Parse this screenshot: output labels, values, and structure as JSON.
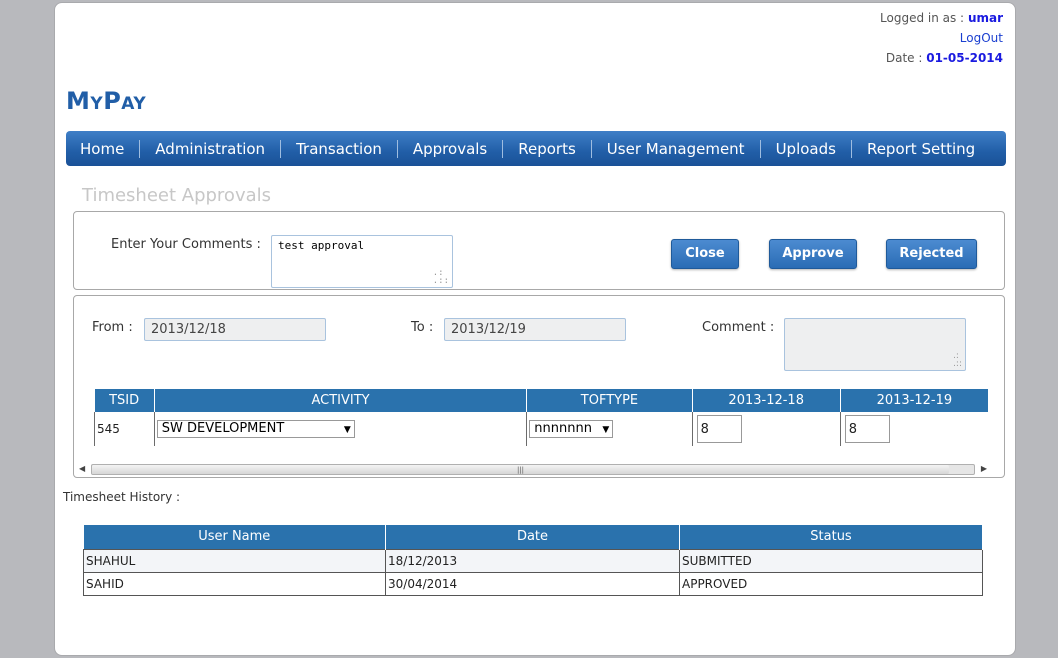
{
  "user": {
    "logged_in_label": "Logged in as :",
    "username": "umar",
    "logout": "LogOut",
    "date_label": "Date :",
    "date": "01-05-2014"
  },
  "brand": {
    "logo": "MyPay",
    "color": "#215ea7"
  },
  "nav": {
    "items": [
      "Home",
      "Administration",
      "Transaction",
      "Approvals",
      "Reports",
      "User Management",
      "Uploads",
      "Report Setting"
    ]
  },
  "page": {
    "title": "Timesheet Approvals"
  },
  "approval": {
    "comments_label": "Enter Your Comments :",
    "comments_value": "test approval",
    "buttons": {
      "close": "Close",
      "approve": "Approve",
      "rejected": "Rejected"
    }
  },
  "filter": {
    "from_label": "From :",
    "from_value": "2013/12/18",
    "to_label": "To :",
    "to_value": "2013/12/19",
    "comment_label": "Comment :",
    "comment_value": ""
  },
  "grid": {
    "headers": [
      "TSID",
      "ACTIVITY",
      "TOFTYPE",
      "2013-12-18",
      "2013-12-19"
    ],
    "rows": [
      {
        "tsid": "545",
        "activity": "SW DEVELOPMENT",
        "toftype": "nnnnnnn",
        "d1": "8",
        "d2": "8"
      }
    ]
  },
  "history": {
    "label": "Timesheet History :",
    "headers": [
      "User Name",
      "Date",
      "Status"
    ],
    "rows": [
      {
        "user": "SHAHUL",
        "date": "18/12/2013",
        "status": "SUBMITTED"
      },
      {
        "user": "SAHID",
        "date": "30/04/2014",
        "status": "APPROVED"
      }
    ]
  },
  "icons": {
    "resize": "resize-grip-icon",
    "dropdown": "chevron-down-icon",
    "scroll_left": "arrow-left-icon",
    "scroll_right": "arrow-right-icon"
  },
  "colors": {
    "header_blue": "#2a72ad",
    "accent": "#1a1ae0"
  }
}
